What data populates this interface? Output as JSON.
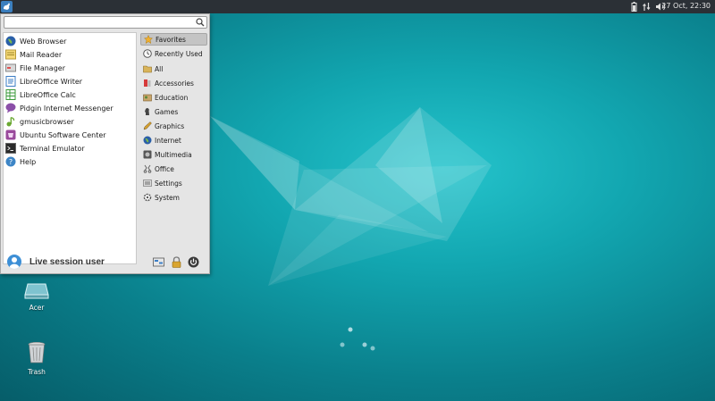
{
  "panel": {
    "clock": "27 Oct, 22:30"
  },
  "search": {
    "placeholder": "",
    "value": ""
  },
  "apps": [
    {
      "label": "Web Browser",
      "icon": "globe-icon"
    },
    {
      "label": "Mail Reader",
      "icon": "mail-icon"
    },
    {
      "label": "File Manager",
      "icon": "file-manager-icon"
    },
    {
      "label": "LibreOffice Writer",
      "icon": "writer-icon"
    },
    {
      "label": "LibreOffice Calc",
      "icon": "calc-icon"
    },
    {
      "label": "Pidgin Internet Messenger",
      "icon": "pidgin-icon"
    },
    {
      "label": "gmusicbrowser",
      "icon": "music-icon"
    },
    {
      "label": "Ubuntu Software Center",
      "icon": "software-center-icon"
    },
    {
      "label": "Terminal Emulator",
      "icon": "terminal-icon"
    },
    {
      "label": "Help",
      "icon": "help-icon"
    }
  ],
  "categories": [
    {
      "label": "Favorites",
      "selected": true
    },
    {
      "label": "Recently Used"
    },
    {
      "label": "All"
    },
    {
      "label": "Accessories"
    },
    {
      "label": "Education"
    },
    {
      "label": "Games"
    },
    {
      "label": "Graphics"
    },
    {
      "label": "Internet"
    },
    {
      "label": "Multimedia"
    },
    {
      "label": "Office"
    },
    {
      "label": "Settings"
    },
    {
      "label": "System"
    }
  ],
  "session": {
    "username": "Live session user"
  },
  "desktop_icons": [
    {
      "label": "Acer",
      "icon": "drive-icon"
    },
    {
      "label": "Trash",
      "icon": "trash-icon"
    }
  ],
  "colors": {
    "panel_bg": "#2b3036",
    "desktop_accent": "#12a6b0",
    "menu_bg": "#e5e5e5"
  }
}
